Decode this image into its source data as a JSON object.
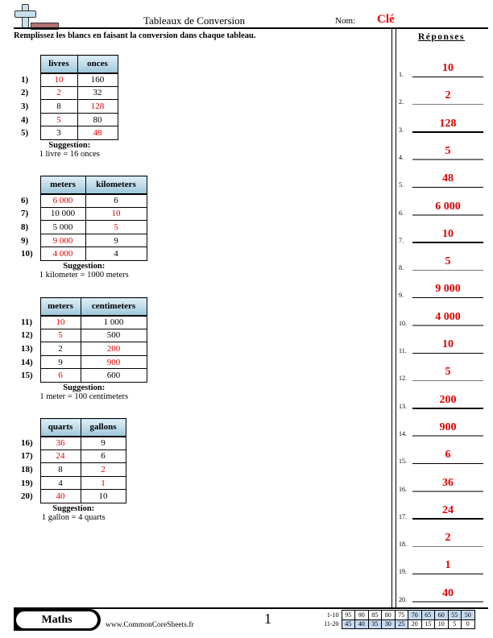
{
  "header": {
    "title": "Tableaux de Conversion",
    "name_label": "Nom:",
    "name_value": "Clé",
    "logo_icon": "plus-minus-icon"
  },
  "instructions": "Remplissez les blancs en faisant la conversion dans chaque tableau.",
  "colors": {
    "answer_red": "#e00000",
    "header_blue": "#b9d8e6",
    "score_highlight": "#c5d9f1"
  },
  "tables": [
    {
      "headers": [
        "livres",
        "onces"
      ],
      "rows": [
        {
          "num": "1)",
          "a": "10",
          "a_answer": true,
          "b": "160",
          "b_answer": false
        },
        {
          "num": "2)",
          "a": "2",
          "a_answer": true,
          "b": "32",
          "b_answer": false
        },
        {
          "num": "3)",
          "a": "8",
          "a_answer": false,
          "b": "128",
          "b_answer": true
        },
        {
          "num": "4)",
          "a": "5",
          "a_answer": true,
          "b": "80",
          "b_answer": false
        },
        {
          "num": "5)",
          "a": "3",
          "a_answer": false,
          "b": "48",
          "b_answer": true
        }
      ],
      "hint_title": "Suggestion:",
      "hint_text": "1 livre = 16 onces"
    },
    {
      "headers": [
        "meters",
        "kilometers"
      ],
      "rows": [
        {
          "num": "6)",
          "a": "6 000",
          "a_answer": true,
          "b": "6",
          "b_answer": false
        },
        {
          "num": "7)",
          "a": "10 000",
          "a_answer": false,
          "b": "10",
          "b_answer": true
        },
        {
          "num": "8)",
          "a": "5 000",
          "a_answer": false,
          "b": "5",
          "b_answer": true
        },
        {
          "num": "9)",
          "a": "9 000",
          "a_answer": true,
          "b": "9",
          "b_answer": false
        },
        {
          "num": "10)",
          "a": "4 000",
          "a_answer": true,
          "b": "4",
          "b_answer": false
        }
      ],
      "hint_title": "Suggestion:",
      "hint_text": "1 kilometer = 1000 meters"
    },
    {
      "headers": [
        "meters",
        "centimeters"
      ],
      "rows": [
        {
          "num": "11)",
          "a": "10",
          "a_answer": true,
          "b": "1 000",
          "b_answer": false
        },
        {
          "num": "12)",
          "a": "5",
          "a_answer": true,
          "b": "500",
          "b_answer": false
        },
        {
          "num": "13)",
          "a": "2",
          "a_answer": false,
          "b": "200",
          "b_answer": true
        },
        {
          "num": "14)",
          "a": "9",
          "a_answer": false,
          "b": "900",
          "b_answer": true
        },
        {
          "num": "15)",
          "a": "6",
          "a_answer": true,
          "b": "600",
          "b_answer": false
        }
      ],
      "hint_title": "Suggestion:",
      "hint_text": "1 meter = 100 centimeters"
    },
    {
      "headers": [
        "quarts",
        "gallons"
      ],
      "rows": [
        {
          "num": "16)",
          "a": "36",
          "a_answer": true,
          "b": "9",
          "b_answer": false
        },
        {
          "num": "17)",
          "a": "24",
          "a_answer": true,
          "b": "6",
          "b_answer": false
        },
        {
          "num": "18)",
          "a": "8",
          "a_answer": false,
          "b": "2",
          "b_answer": true
        },
        {
          "num": "19)",
          "a": "4",
          "a_answer": false,
          "b": "1",
          "b_answer": true
        },
        {
          "num": "20)",
          "a": "40",
          "a_answer": true,
          "b": "10",
          "b_answer": false
        }
      ],
      "hint_title": "Suggestion:",
      "hint_text": "1 gallon = 4 quarts"
    }
  ],
  "answers": {
    "title": "Réponses",
    "items": [
      {
        "num": "1.",
        "value": "10"
      },
      {
        "num": "2.",
        "value": "2"
      },
      {
        "num": "3.",
        "value": "128"
      },
      {
        "num": "4.",
        "value": "5"
      },
      {
        "num": "5.",
        "value": "48"
      },
      {
        "num": "6.",
        "value": "6 000"
      },
      {
        "num": "7.",
        "value": "10"
      },
      {
        "num": "8.",
        "value": "5"
      },
      {
        "num": "9.",
        "value": "9 000"
      },
      {
        "num": "10.",
        "value": "4 000"
      },
      {
        "num": "11.",
        "value": "10"
      },
      {
        "num": "12.",
        "value": "5"
      },
      {
        "num": "13.",
        "value": "200"
      },
      {
        "num": "14.",
        "value": "900"
      },
      {
        "num": "15.",
        "value": "6"
      },
      {
        "num": "16.",
        "value": "36"
      },
      {
        "num": "17.",
        "value": "24"
      },
      {
        "num": "18.",
        "value": "2"
      },
      {
        "num": "19.",
        "value": "1"
      },
      {
        "num": "20.",
        "value": "40"
      }
    ]
  },
  "footer": {
    "subject": "Maths",
    "site": "www.CommonCoreSheets.fr",
    "page": "1",
    "score_rows": [
      {
        "label": "1-10",
        "cells": [
          "95",
          "90",
          "85",
          "80",
          "75",
          "70",
          "65",
          "60",
          "55",
          "50"
        ],
        "highlight": [
          false,
          false,
          false,
          false,
          false,
          true,
          true,
          true,
          true,
          true
        ]
      },
      {
        "label": "11-20",
        "cells": [
          "45",
          "40",
          "35",
          "30",
          "25",
          "20",
          "15",
          "10",
          "5",
          "0"
        ],
        "highlight": [
          true,
          true,
          true,
          true,
          true,
          false,
          false,
          false,
          false,
          false
        ]
      }
    ]
  }
}
